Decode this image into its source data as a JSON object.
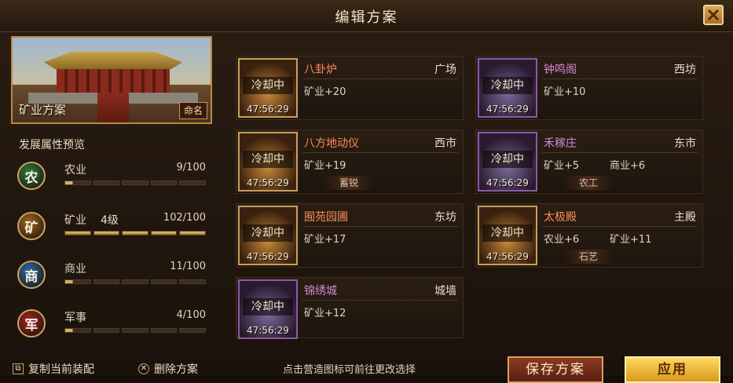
{
  "window": {
    "title": "编辑方案",
    "close_icon": "close-icon"
  },
  "scheme": {
    "name": "矿业方案",
    "rename_label": "命名"
  },
  "preview": {
    "title": "发展属性预览",
    "attributes": [
      {
        "badge": "农",
        "badge_color": "#2f7a3a",
        "name": "农业",
        "level": "",
        "value": "9/100",
        "fraction": 0.09
      },
      {
        "badge": "矿",
        "badge_color": "#a0661e",
        "name": "矿业",
        "level": "4级",
        "value": "102/100",
        "fraction": 1.0
      },
      {
        "badge": "商",
        "badge_color": "#2a6aa0",
        "name": "商业",
        "level": "",
        "value": "11/100",
        "fraction": 0.11
      },
      {
        "badge": "军",
        "badge_color": "#a02424",
        "name": "军事",
        "level": "",
        "value": "4/100",
        "fraction": 0.04
      }
    ]
  },
  "buildings": [
    {
      "name": "八卦炉",
      "location": "广场",
      "status": "冷却中",
      "timer": "47:56:29",
      "stats": [
        "矿业+20"
      ],
      "tag": "",
      "rarity": "orange"
    },
    {
      "name": "钟鸣阁",
      "location": "西坊",
      "status": "冷却中",
      "timer": "47:56:29",
      "stats": [
        "矿业+10"
      ],
      "tag": "",
      "rarity": "purple"
    },
    {
      "name": "八方地动仪",
      "location": "西市",
      "status": "冷却中",
      "timer": "47:56:29",
      "stats": [
        "矿业+19"
      ],
      "tag": "蓄锐",
      "rarity": "orange"
    },
    {
      "name": "禾稼庄",
      "location": "东市",
      "status": "冷却中",
      "timer": "47:56:29",
      "stats": [
        "矿业+5",
        "商业+6"
      ],
      "tag": "农工",
      "rarity": "purple"
    },
    {
      "name": "囿苑园圃",
      "location": "东坊",
      "status": "冷却中",
      "timer": "47:56:29",
      "stats": [
        "矿业+17"
      ],
      "tag": "",
      "rarity": "orange"
    },
    {
      "name": "太极殿",
      "location": "主殿",
      "status": "冷却中",
      "timer": "47:56:29",
      "stats": [
        "农业+6",
        "矿业+11"
      ],
      "tag": "石艺",
      "rarity": "orange"
    },
    {
      "name": "锦绣城",
      "location": "城墙",
      "status": "冷却中",
      "timer": "47:56:29",
      "stats": [
        "矿业+12"
      ],
      "tag": "",
      "rarity": "purple"
    }
  ],
  "footer": {
    "copy_label": "复制当前装配",
    "delete_label": "删除方案",
    "hint": "点击营造图标可前往更改选择",
    "save_label": "保存方案",
    "apply_label": "应用"
  }
}
